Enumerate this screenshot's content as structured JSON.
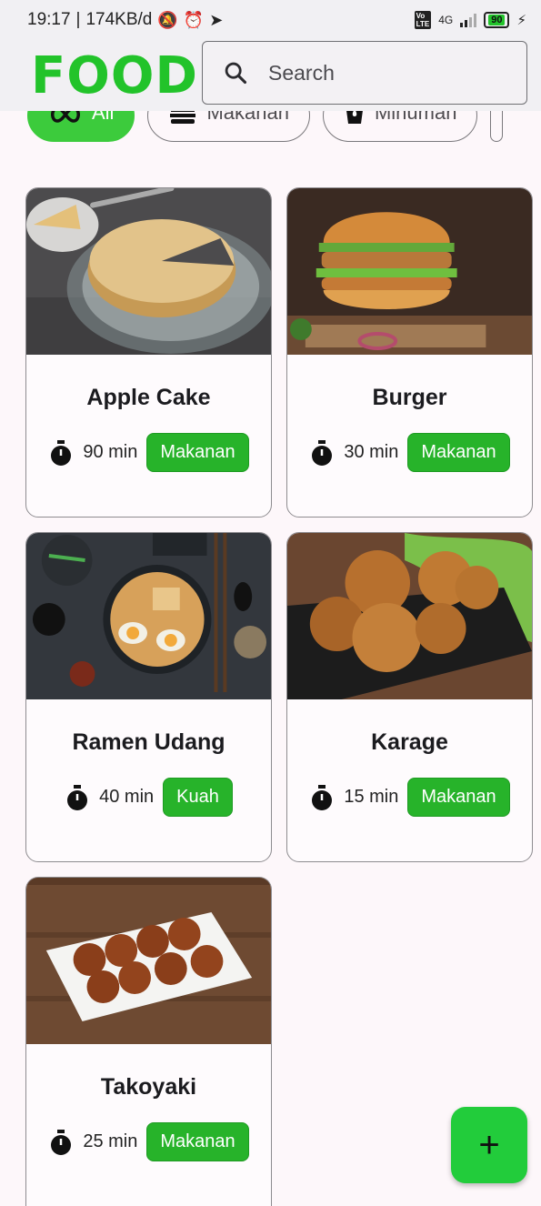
{
  "status_bar": {
    "time": "19:17",
    "speed": "174KB/d",
    "network": "4G",
    "battery": "90"
  },
  "header": {
    "logo": "FOOD",
    "search_placeholder": "Search"
  },
  "chips": [
    {
      "label": "All",
      "icon": "infinity-icon",
      "active": true
    },
    {
      "label": "Makanan",
      "icon": "burger-icon",
      "active": false
    },
    {
      "label": "Minuman",
      "icon": "drink-icon",
      "active": false
    }
  ],
  "recipes": [
    {
      "title": "Apple Cake",
      "time": "90 min",
      "category": "Makanan"
    },
    {
      "title": "Burger",
      "time": "30 min",
      "category": "Makanan"
    },
    {
      "title": "Ramen Udang",
      "time": "40 min",
      "category": "Kuah"
    },
    {
      "title": "Karage",
      "time": "15 min",
      "category": "Makanan"
    },
    {
      "title": "Takoyaki",
      "time": "25 min",
      "category": "Makanan"
    }
  ],
  "fab": {
    "label": "+"
  },
  "colors": {
    "brand": "#22c32a",
    "tag": "#27b32a",
    "fab": "#22cc3b"
  }
}
